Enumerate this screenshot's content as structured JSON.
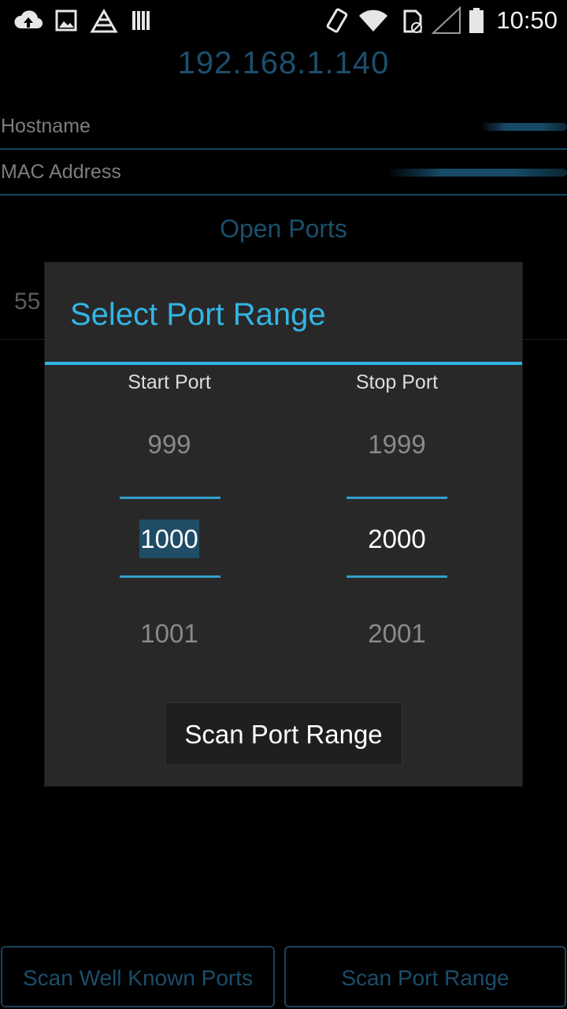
{
  "status_bar": {
    "time": "10:50",
    "icons": [
      "cloud-upload-icon",
      "image-icon",
      "logo-icon",
      "barcode-icon",
      "vibrate-icon",
      "wifi-icon",
      "sd-card-icon",
      "signal-icon",
      "battery-icon"
    ]
  },
  "device": {
    "ip": "192.168.1.140",
    "hostname_label": "Hostname",
    "mac_label": "MAC Address"
  },
  "open_ports": {
    "title": "Open Ports",
    "items": [
      "55"
    ]
  },
  "dialog": {
    "title": "Select Port Range",
    "start": {
      "label": "Start Port",
      "prev": "999",
      "current": "1000",
      "next": "1001"
    },
    "stop": {
      "label": "Stop Port",
      "prev": "1999",
      "current": "2000",
      "next": "2001"
    },
    "scan_button": "Scan Port Range"
  },
  "bottom_buttons": {
    "well_known": "Scan Well Known Ports",
    "range": "Scan Port Range"
  },
  "colors": {
    "accent": "#33b5e5",
    "dim_accent": "#1c4f6e",
    "dialog_bg": "#282828"
  }
}
